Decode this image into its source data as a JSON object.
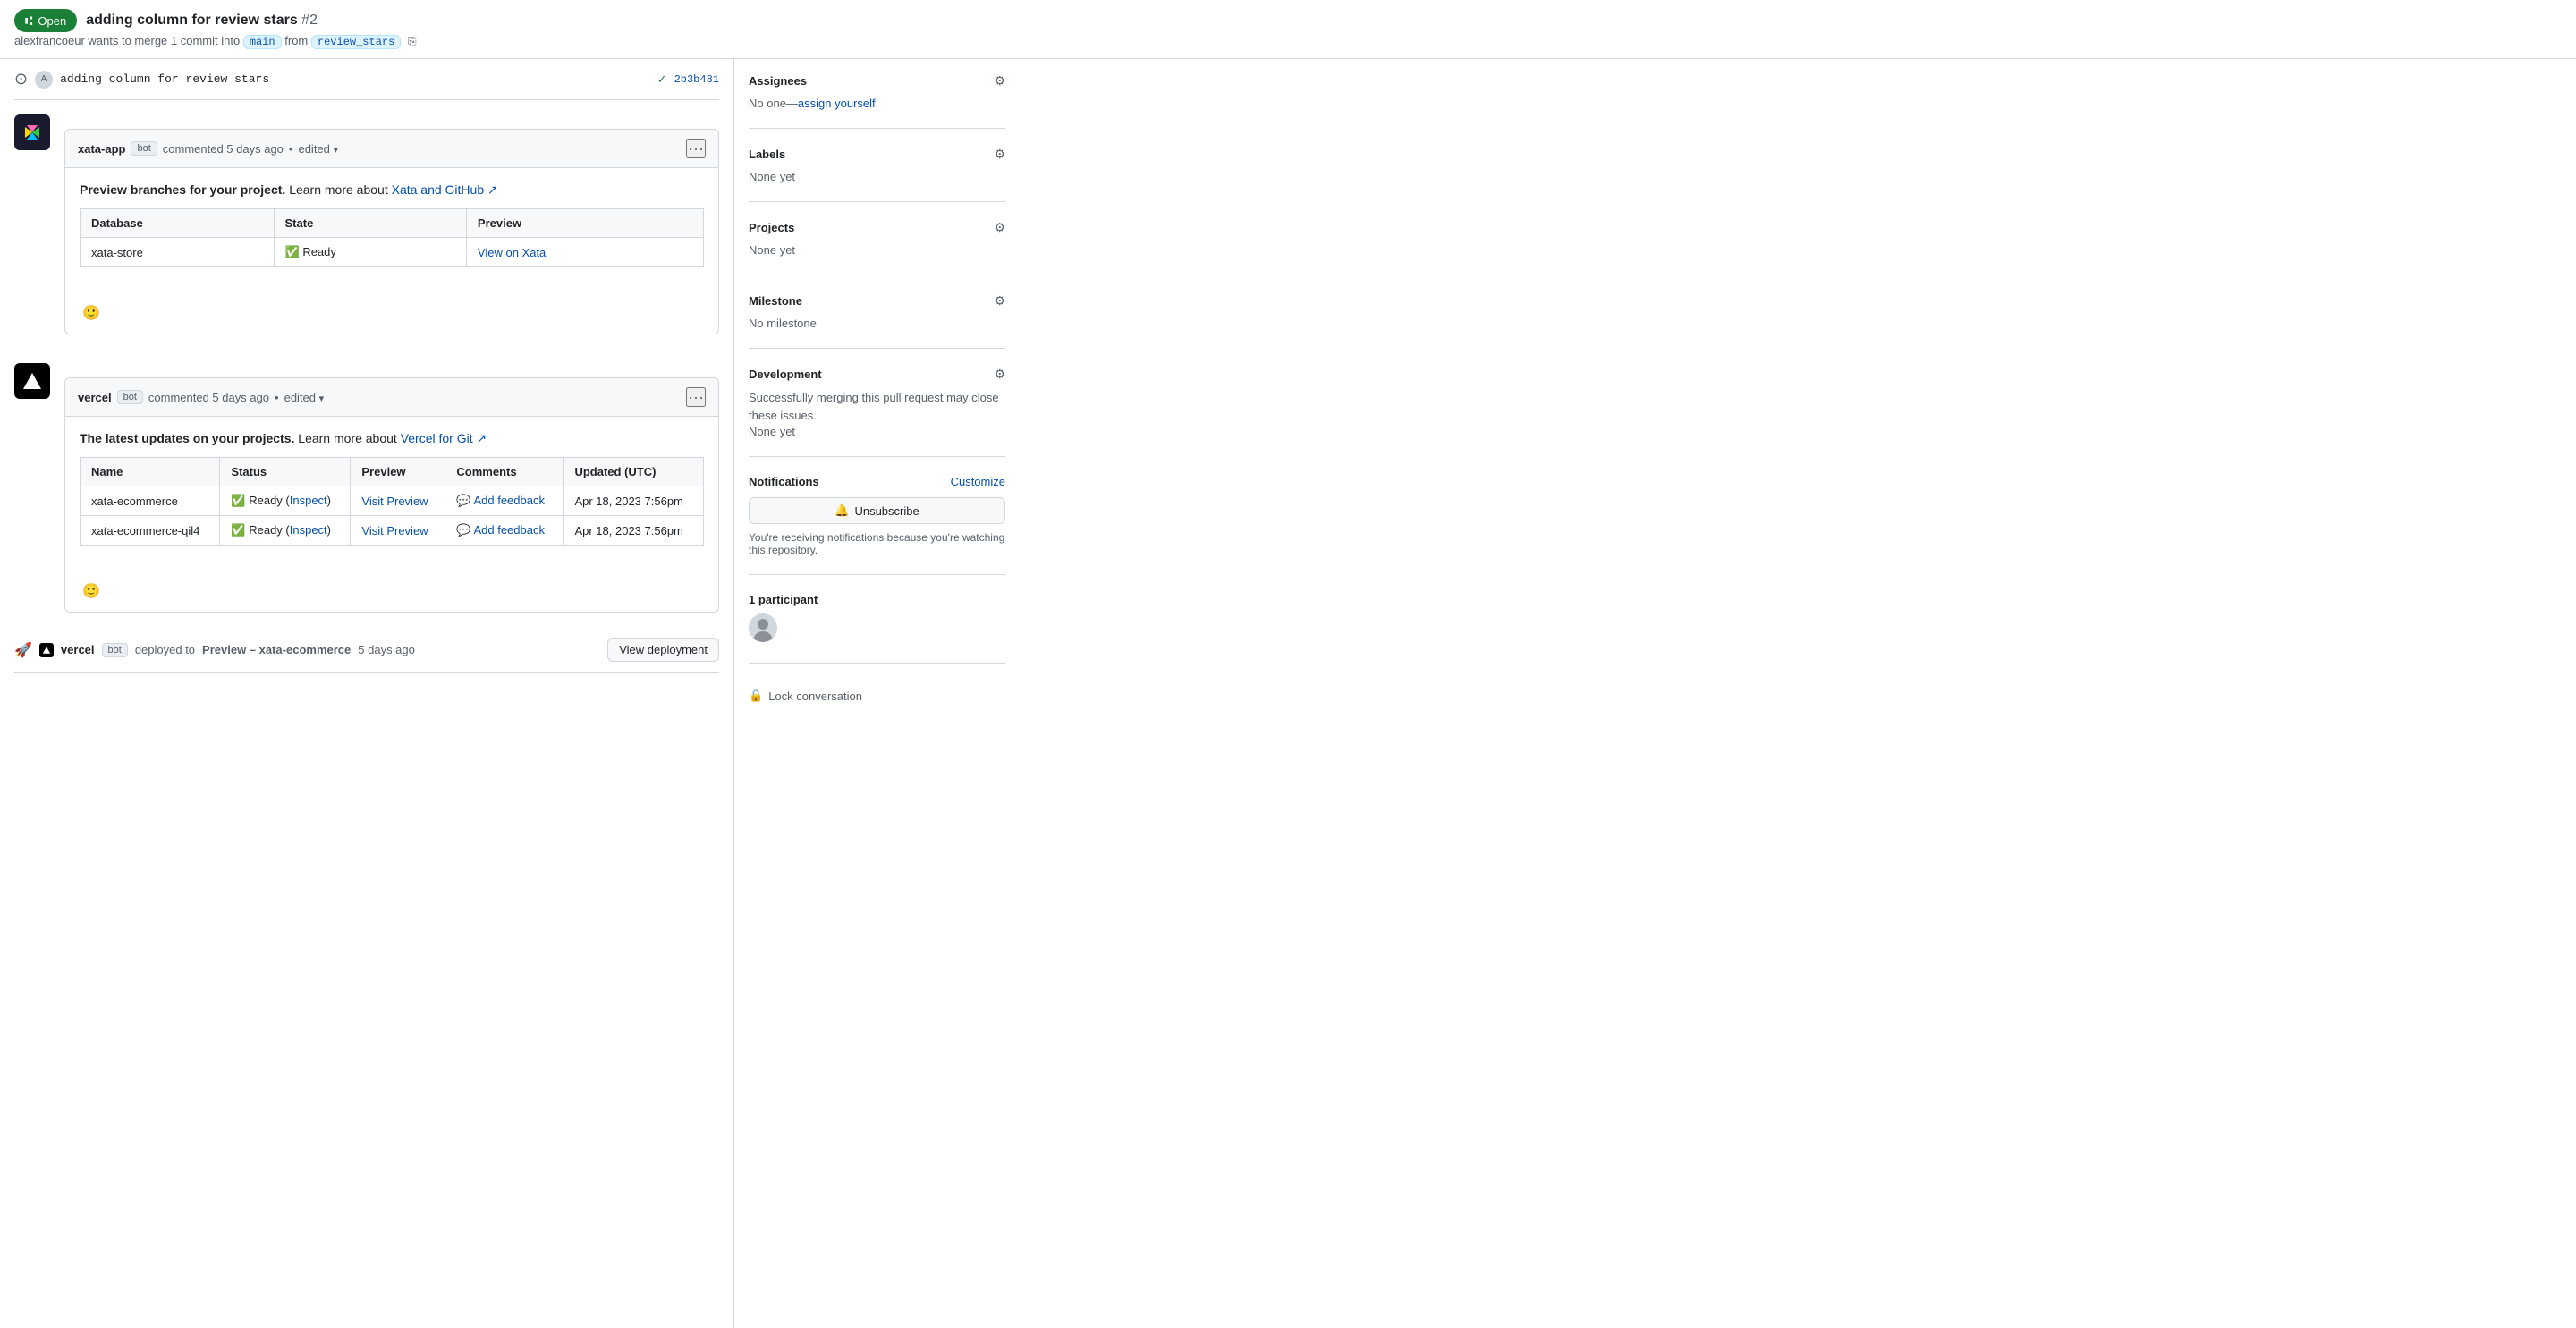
{
  "topbar": {
    "badge_label": "Open",
    "pr_title": "adding column for review stars",
    "pr_number": "#2",
    "author": "alexfrancoeur",
    "merge_text": "wants to merge 1 commit into",
    "base_branch": "main",
    "from_text": "from",
    "head_branch": "review_stars"
  },
  "commit": {
    "message": "adding column for review stars",
    "hash": "2b3b481",
    "author_initial": "A"
  },
  "comment_xata": {
    "author": "xata-app",
    "bot_label": "bot",
    "meta": "commented 5 days ago",
    "edited": "edited",
    "intro": "Preview branches for your project.",
    "learn_more": "Learn more about",
    "learn_link_text": "Xata and GitHub ↗",
    "table_headers": [
      "Database",
      "State",
      "Preview"
    ],
    "table_rows": [
      {
        "database": "xata-store",
        "state": "✅ Ready",
        "preview": "View on Xata"
      }
    ]
  },
  "comment_vercel": {
    "author": "vercel",
    "bot_label": "bot",
    "meta": "commented 5 days ago",
    "edited": "edited",
    "intro": "The latest updates on your projects.",
    "learn_more": "Learn more about",
    "learn_link_text": "Vercel for Git ↗",
    "table_headers": [
      "Name",
      "Status",
      "Preview",
      "Comments",
      "Updated (UTC)"
    ],
    "table_rows": [
      {
        "name": "xata-ecommerce",
        "status": "✅ Ready",
        "inspect_link": "Inspect",
        "preview": "Visit Preview",
        "comments": "Add feedback",
        "updated": "Apr 18, 2023 7:56pm"
      },
      {
        "name": "xata-ecommerce-qil4",
        "status": "✅ Ready",
        "inspect_link": "Inspect",
        "preview": "Visit Preview",
        "comments": "Add feedback",
        "updated": "Apr 18, 2023 7:56pm"
      }
    ]
  },
  "deployment": {
    "deployer": "vercel",
    "bot_label": "bot",
    "action": "deployed to",
    "environment": "Preview – xata-ecommerce",
    "time": "5 days ago",
    "button_label": "View deployment"
  },
  "sidebar": {
    "assignees_title": "Assignees",
    "assignees_value": "No one—",
    "assign_yourself": "assign yourself",
    "labels_title": "Labels",
    "labels_value": "None yet",
    "projects_title": "Projects",
    "projects_value": "None yet",
    "milestone_title": "Milestone",
    "milestone_value": "No milestone",
    "development_title": "Development",
    "development_text": "Successfully merging this pull request may close these issues.",
    "development_value": "None yet",
    "notifications_title": "Notifications",
    "customize_label": "Customize",
    "unsubscribe_label": "Unsubscribe",
    "notify_text": "You're receiving notifications because you're watching this repository.",
    "participants_title": "1 participant",
    "lock_label": "Lock conversation"
  }
}
